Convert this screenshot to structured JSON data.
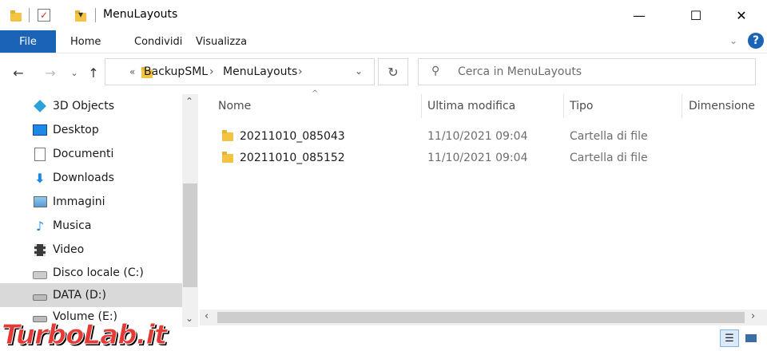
{
  "window": {
    "title": "MenuLayouts",
    "minimize_glyph": "—",
    "maximize_glyph": "☐",
    "close_glyph": "✕",
    "quick_access_dropdown": "▾"
  },
  "ribbon": {
    "tabs": [
      {
        "label": "File"
      },
      {
        "label": "Home"
      },
      {
        "label": "Condividi"
      },
      {
        "label": "Visualizza"
      }
    ],
    "help_glyph": "?"
  },
  "address": {
    "overflow": "«",
    "breadcrumb": [
      "BackupSML",
      "MenuLayouts"
    ],
    "sep": "›"
  },
  "search": {
    "placeholder": "Cerca in MenuLayouts"
  },
  "sidebar": {
    "items": [
      {
        "label": "3D Objects",
        "icon": "3d-objects-icon"
      },
      {
        "label": "Desktop",
        "icon": "desktop-icon"
      },
      {
        "label": "Documenti",
        "icon": "documents-icon"
      },
      {
        "label": "Downloads",
        "icon": "downloads-icon"
      },
      {
        "label": "Immagini",
        "icon": "pictures-icon"
      },
      {
        "label": "Musica",
        "icon": "music-icon"
      },
      {
        "label": "Video",
        "icon": "video-icon"
      },
      {
        "label": "Disco locale (C:)",
        "icon": "local-disk-icon"
      },
      {
        "label": "DATA (D:)",
        "icon": "drive-icon",
        "selected": true
      },
      {
        "label": "Volume (E:)",
        "icon": "drive-icon"
      }
    ]
  },
  "columns": {
    "name": "Nome",
    "modified": "Ultima modifica",
    "type": "Tipo",
    "size": "Dimensione"
  },
  "files": [
    {
      "name": "20211010_085043",
      "modified": "11/10/2021 09:04",
      "type": "Cartella di file"
    },
    {
      "name": "20211010_085152",
      "modified": "11/10/2021 09:04",
      "type": "Cartella di file"
    }
  ],
  "watermark": {
    "text": "TurboLab.it"
  },
  "colors": {
    "accent": "#1a63b6",
    "folder": "#f3c442",
    "watermark": "#e53935"
  }
}
